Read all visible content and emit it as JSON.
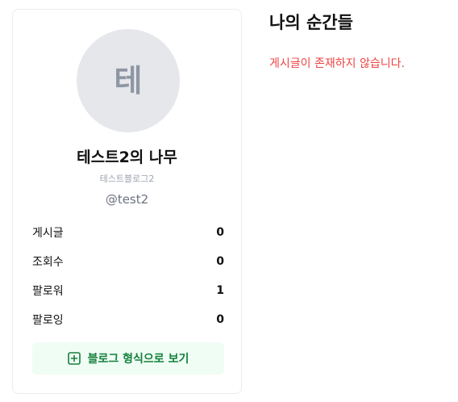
{
  "profile": {
    "avatar_initial": "테",
    "blog_title": "테스트2의 나무",
    "blog_subtitle": "테스트블로그2",
    "handle": "@test2",
    "stats": [
      {
        "label": "게시글",
        "value": "0"
      },
      {
        "label": "조회수",
        "value": "0"
      },
      {
        "label": "팔로워",
        "value": "1"
      },
      {
        "label": "팔로잉",
        "value": "0"
      }
    ],
    "view_button_label": "블로그 형식으로 보기",
    "view_button_icon": "plus-square-icon"
  },
  "main": {
    "title": "나의 순간들",
    "empty_message": "게시글이 존재하지 않습니다."
  },
  "colors": {
    "accent_green": "#15803d",
    "button_bg": "#f0fdf4",
    "error_red": "#ef4444",
    "avatar_bg": "#e5e7eb"
  }
}
